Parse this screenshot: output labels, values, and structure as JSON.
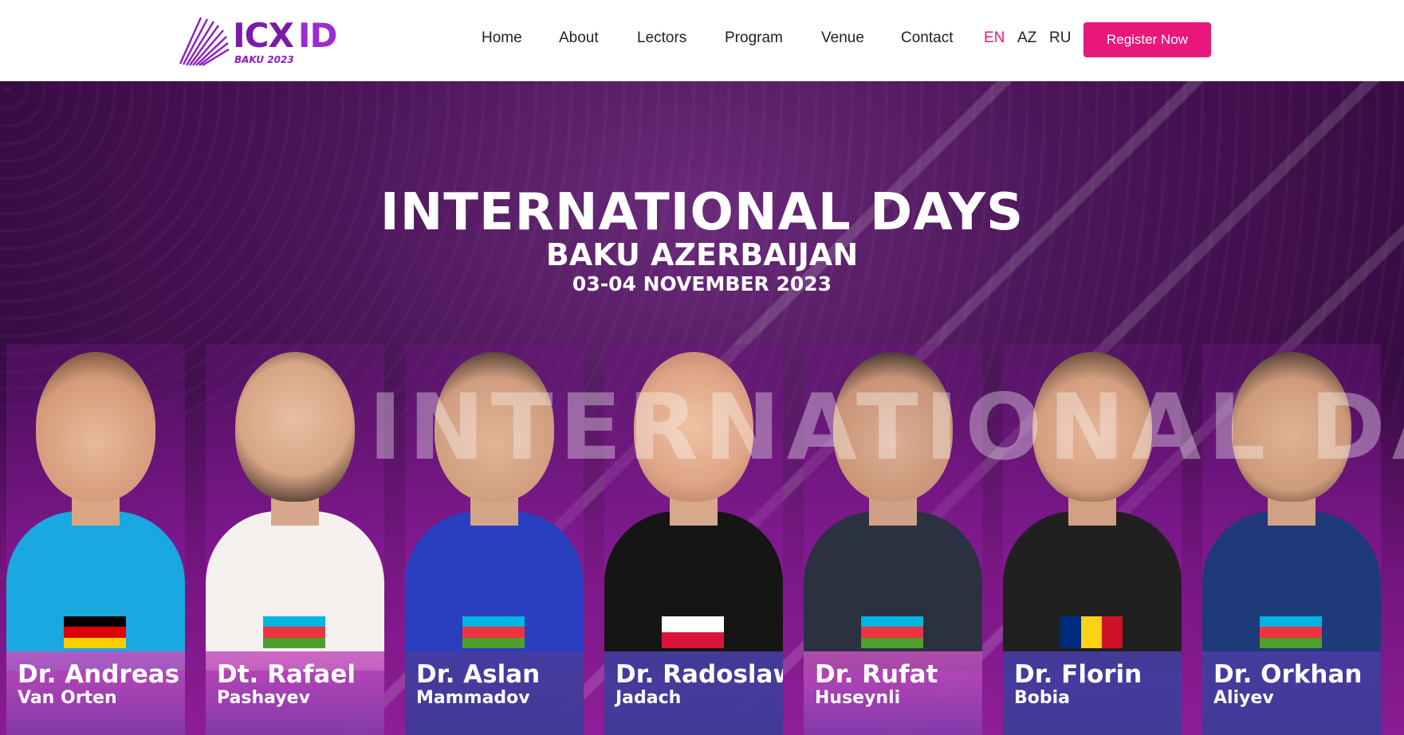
{
  "nav": {
    "logo_text": "ICX",
    "logo_text_id": "ID",
    "logo_sub": "BAKU 2023",
    "links": [
      "Home",
      "About",
      "Lectors",
      "Program",
      "Venue",
      "Contact"
    ],
    "languages": [
      "EN",
      "AZ",
      "RU"
    ],
    "active_language": "EN",
    "register_label": "Register Now"
  },
  "hero": {
    "title": "INTERNATIONAL DAYS",
    "subtitle": "BAKU AZERBAIJAN",
    "dates": "03-04 NOVEMBER 2023",
    "watermark": "INTERNATIONAL DAYS",
    "speakers": [
      {
        "first": "Dr. Andreas",
        "last": "Van Orten",
        "flag": "de-flag-icon"
      },
      {
        "first": "Dt. Rafael",
        "last": "Pashayev",
        "flag": "az-flag-icon"
      },
      {
        "first": "Dr. Aslan",
        "last": "Mammadov",
        "flag": "az-flag-icon"
      },
      {
        "first": "Dr. Radoslaw",
        "last": "Jadach",
        "flag": "pl-flag-icon"
      },
      {
        "first": "Dr. Rufat",
        "last": "Huseynli",
        "flag": "az-flag-icon"
      },
      {
        "first": "Dr. Florin",
        "last": "Bobia",
        "flag": "ro-flag-icon"
      },
      {
        "first": "Dr. Orkhan",
        "last": "Aliyev",
        "flag": "az-flag-icon"
      }
    ]
  },
  "colors": {
    "accent": "#e8177a",
    "brand_purple": "#7a1aa8"
  }
}
